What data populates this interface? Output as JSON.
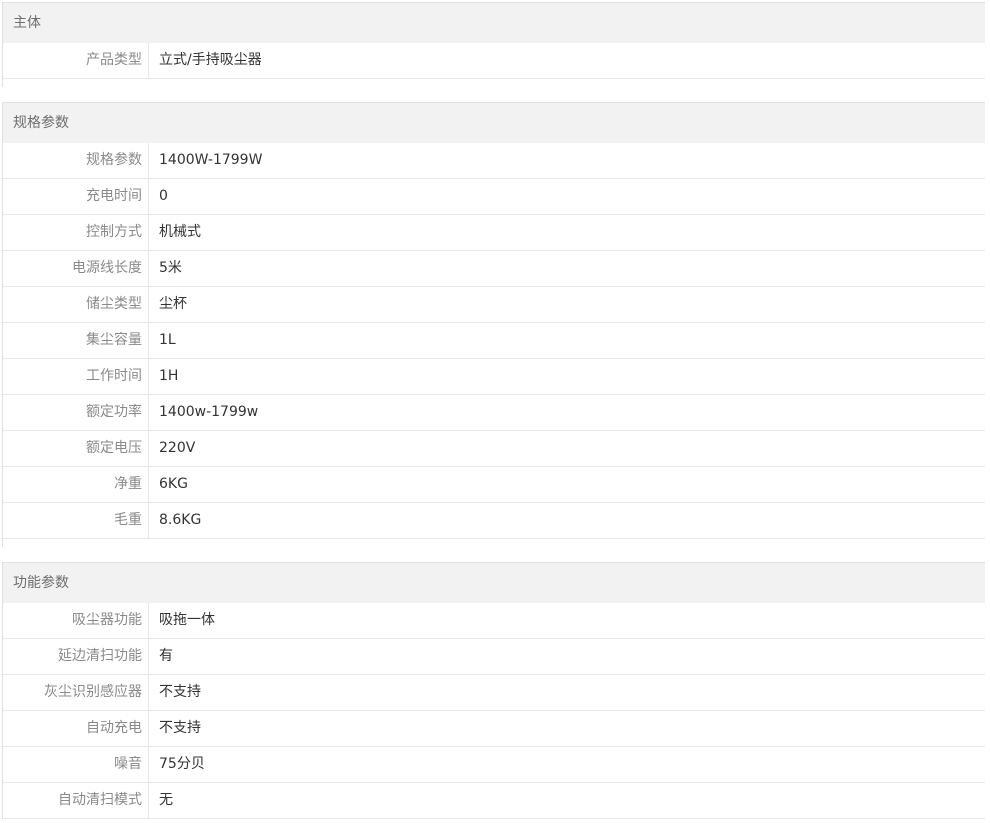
{
  "sections": [
    {
      "title": "主体",
      "rows": [
        {
          "label": "产品类型",
          "value": "立式/手持吸尘器"
        }
      ]
    },
    {
      "title": "规格参数",
      "rows": [
        {
          "label": "规格参数",
          "value": "1400W-1799W"
        },
        {
          "label": "充电时间",
          "value": "0"
        },
        {
          "label": "控制方式",
          "value": "机械式"
        },
        {
          "label": "电源线长度",
          "value": "5米"
        },
        {
          "label": "储尘类型",
          "value": "尘杯"
        },
        {
          "label": "集尘容量",
          "value": "1L"
        },
        {
          "label": "工作时间",
          "value": "1H"
        },
        {
          "label": "额定功率",
          "value": "1400w-1799w"
        },
        {
          "label": "额定电压",
          "value": "220V"
        },
        {
          "label": "净重",
          "value": "6KG"
        },
        {
          "label": "毛重",
          "value": "8.6KG"
        }
      ]
    },
    {
      "title": "功能参数",
      "rows": [
        {
          "label": "吸尘器功能",
          "value": "吸拖一体"
        },
        {
          "label": "延边清扫功能",
          "value": "有"
        },
        {
          "label": "灰尘识别感应器",
          "value": "不支持"
        },
        {
          "label": "自动充电",
          "value": "不支持"
        },
        {
          "label": "噪音",
          "value": "75分贝"
        },
        {
          "label": "自动清扫模式",
          "value": "无"
        }
      ]
    }
  ]
}
